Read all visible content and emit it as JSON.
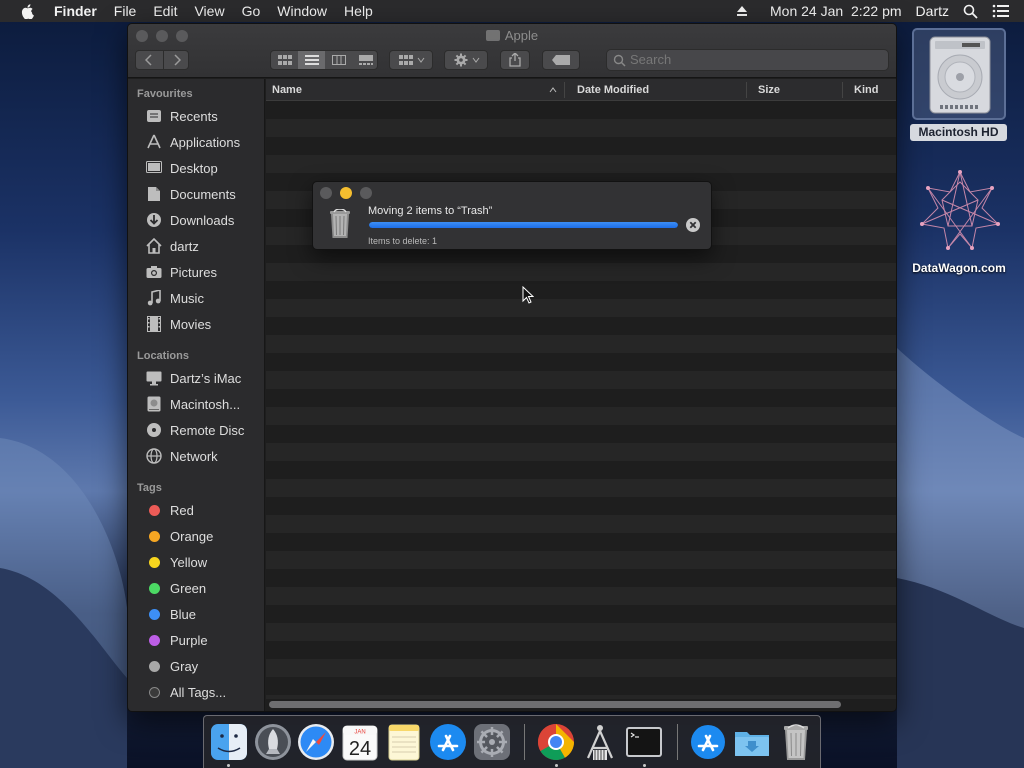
{
  "menubar": {
    "app_name": "Finder",
    "menus": [
      "File",
      "Edit",
      "View",
      "Go",
      "Window",
      "Help"
    ],
    "clock": "Mon 24 Jan  2:22 pm",
    "user": "Dartz"
  },
  "window": {
    "title": "Apple",
    "search_placeholder": "Search"
  },
  "sidebar": {
    "favourites_label": "Favourites",
    "favourites": [
      {
        "label": "Recents",
        "icon": "clock-icon"
      },
      {
        "label": "Applications",
        "icon": "applications-icon"
      },
      {
        "label": "Desktop",
        "icon": "desktop-icon"
      },
      {
        "label": "Documents",
        "icon": "document-icon"
      },
      {
        "label": "Downloads",
        "icon": "download-icon"
      },
      {
        "label": "dartz",
        "icon": "home-icon"
      },
      {
        "label": "Pictures",
        "icon": "camera-icon"
      },
      {
        "label": "Music",
        "icon": "music-note-icon"
      },
      {
        "label": "Movies",
        "icon": "film-icon"
      }
    ],
    "locations_label": "Locations",
    "locations": [
      {
        "label": "Dartz’s iMac",
        "icon": "imac-icon"
      },
      {
        "label": "Macintosh...",
        "icon": "hard-disk-icon"
      },
      {
        "label": "Remote Disc",
        "icon": "disc-icon"
      },
      {
        "label": "Network",
        "icon": "globe-icon"
      }
    ],
    "tags_label": "Tags",
    "tags": [
      {
        "label": "Red",
        "color": "#ec5b57"
      },
      {
        "label": "Orange",
        "color": "#f5a623"
      },
      {
        "label": "Yellow",
        "color": "#f7d51e"
      },
      {
        "label": "Green",
        "color": "#4cd964"
      },
      {
        "label": "Blue",
        "color": "#3d8ff5"
      },
      {
        "label": "Purple",
        "color": "#bd5ee6"
      },
      {
        "label": "Gray",
        "color": "#a8a8a8"
      }
    ],
    "all_tags_label": "All Tags..."
  },
  "columns": {
    "name": "Name",
    "date_modified": "Date Modified",
    "size": "Size",
    "kind": "Kind"
  },
  "progress": {
    "title": "Moving 2 items to “Trash”",
    "status": "Items to delete: 1",
    "fraction": 1.0
  },
  "desktop": {
    "hd_label": "Macintosh HD",
    "datawagon_label": "DataWagon.com"
  },
  "dock": {
    "items": [
      "Finder",
      "Launchpad",
      "Safari",
      "Calendar",
      "Notes",
      "App Store",
      "System Preferences",
      "Chrome",
      "Python Launcher",
      "Terminal",
      "Applications",
      "Downloads",
      "Trash"
    ],
    "calendar_month": "JAN",
    "calendar_day": "24"
  },
  "colors": {
    "accent": "#1d6ee8",
    "close": "#5a5a5c",
    "minimize_active": "#f5be2f"
  }
}
